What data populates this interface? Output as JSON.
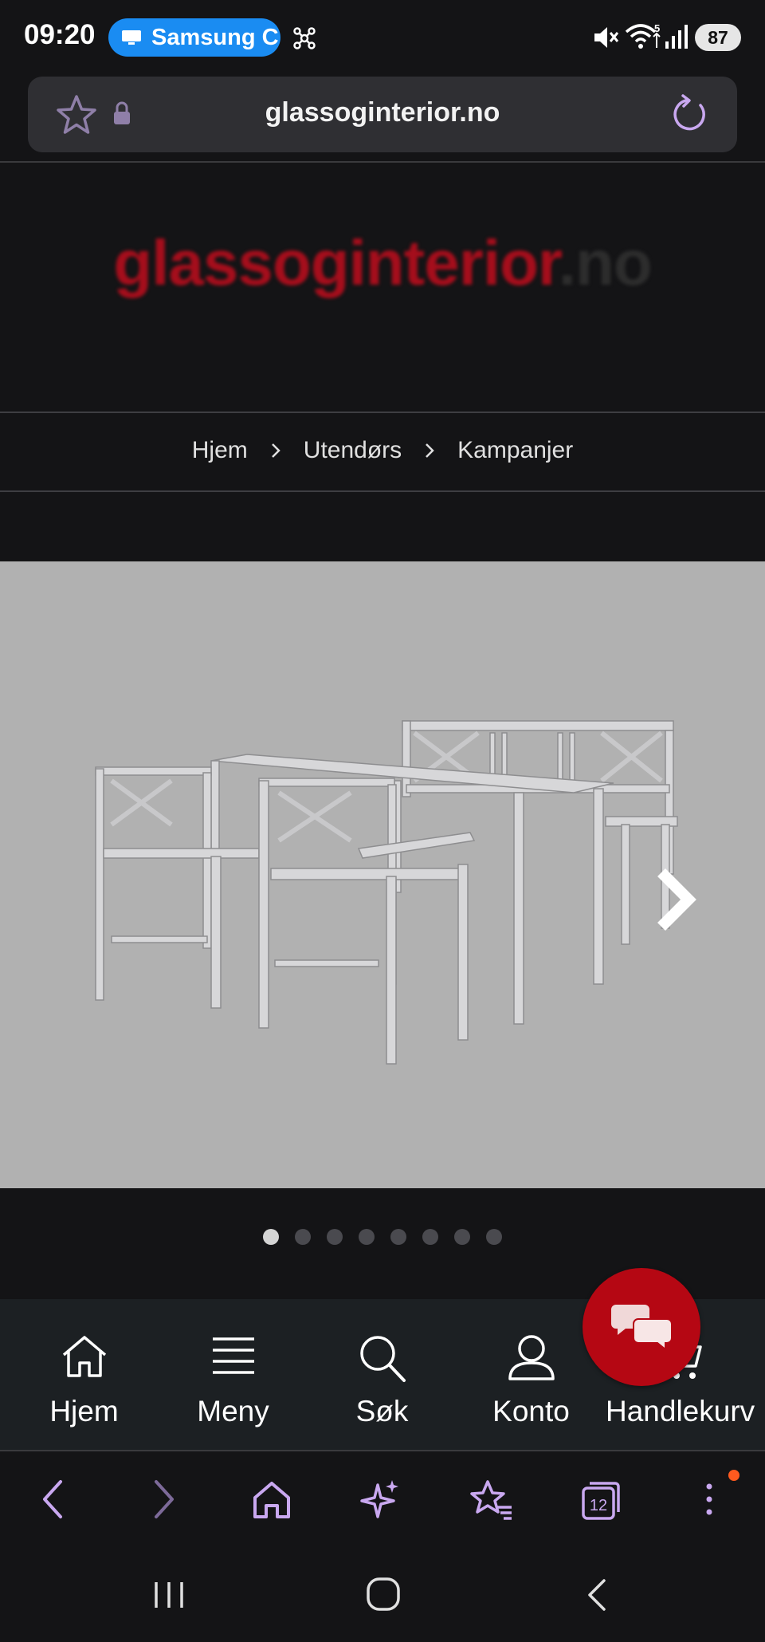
{
  "status_bar": {
    "time": "09:20",
    "notification_pill": "Samsung C",
    "battery": "87",
    "wifi_badge": "5"
  },
  "url_bar": {
    "url": "glassoginterior.no"
  },
  "site": {
    "logo_main": "glassoginterior",
    "logo_suffix": ".no"
  },
  "breadcrumb": {
    "items": [
      "Hjem",
      "Utendørs",
      "Kampanjer"
    ]
  },
  "gallery": {
    "slide_count": 8,
    "active_index": 0
  },
  "bottom_nav": {
    "items": [
      {
        "label": "Hjem",
        "icon": "home-icon"
      },
      {
        "label": "Meny",
        "icon": "menu-icon"
      },
      {
        "label": "Søk",
        "icon": "search-icon"
      },
      {
        "label": "Konto",
        "icon": "account-icon"
      },
      {
        "label": "Handlekurv",
        "icon": "cart-icon"
      }
    ]
  },
  "chat": {
    "icon": "chat-icon",
    "color": "#b50713"
  },
  "browser_toolbar": {
    "tabs_count": "12",
    "accent": "#c9a8f0"
  }
}
